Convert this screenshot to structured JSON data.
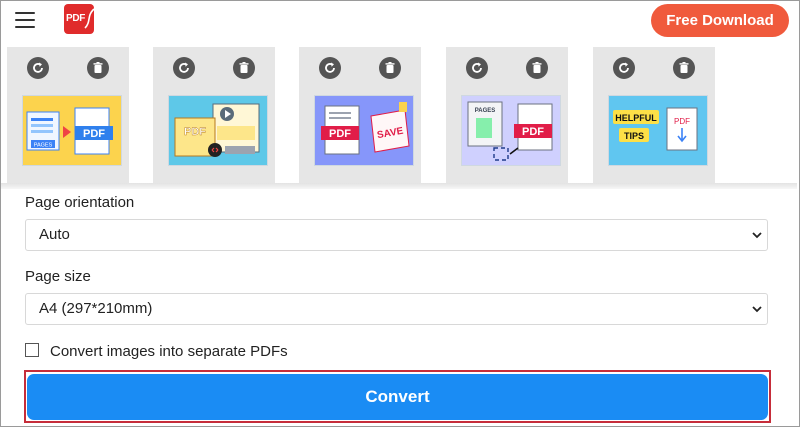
{
  "header": {
    "menu_icon": "hamburger-menu-icon",
    "logo_text": "PDF",
    "free_download_label": "Free Download",
    "accent_color": "#f05a3c"
  },
  "thumbnails": [
    {
      "rotate_icon": "rotate-icon",
      "delete_icon": "trash-icon",
      "image_text": [
        "PAGES",
        "PDF"
      ]
    },
    {
      "rotate_icon": "rotate-icon",
      "delete_icon": "trash-icon",
      "image_text": [
        "PDF"
      ]
    },
    {
      "rotate_icon": "rotate-icon",
      "delete_icon": "trash-icon",
      "image_text": [
        "PDF",
        "SAVE"
      ]
    },
    {
      "rotate_icon": "rotate-icon",
      "delete_icon": "trash-icon",
      "image_text": [
        "PAGES",
        "PDF"
      ]
    },
    {
      "rotate_icon": "rotate-icon",
      "delete_icon": "trash-icon",
      "image_text": [
        "HELPFUL",
        "TIPS",
        "PDF"
      ]
    }
  ],
  "form": {
    "orientation_label": "Page orientation",
    "orientation_value": "Auto",
    "size_label": "Page size",
    "size_value": "A4 (297*210mm)",
    "separate_label": "Convert images into separate PDFs",
    "separate_checked": false,
    "convert_label": "Convert",
    "convert_color": "#1a8cf4",
    "highlight_color": "#c62d3a"
  }
}
